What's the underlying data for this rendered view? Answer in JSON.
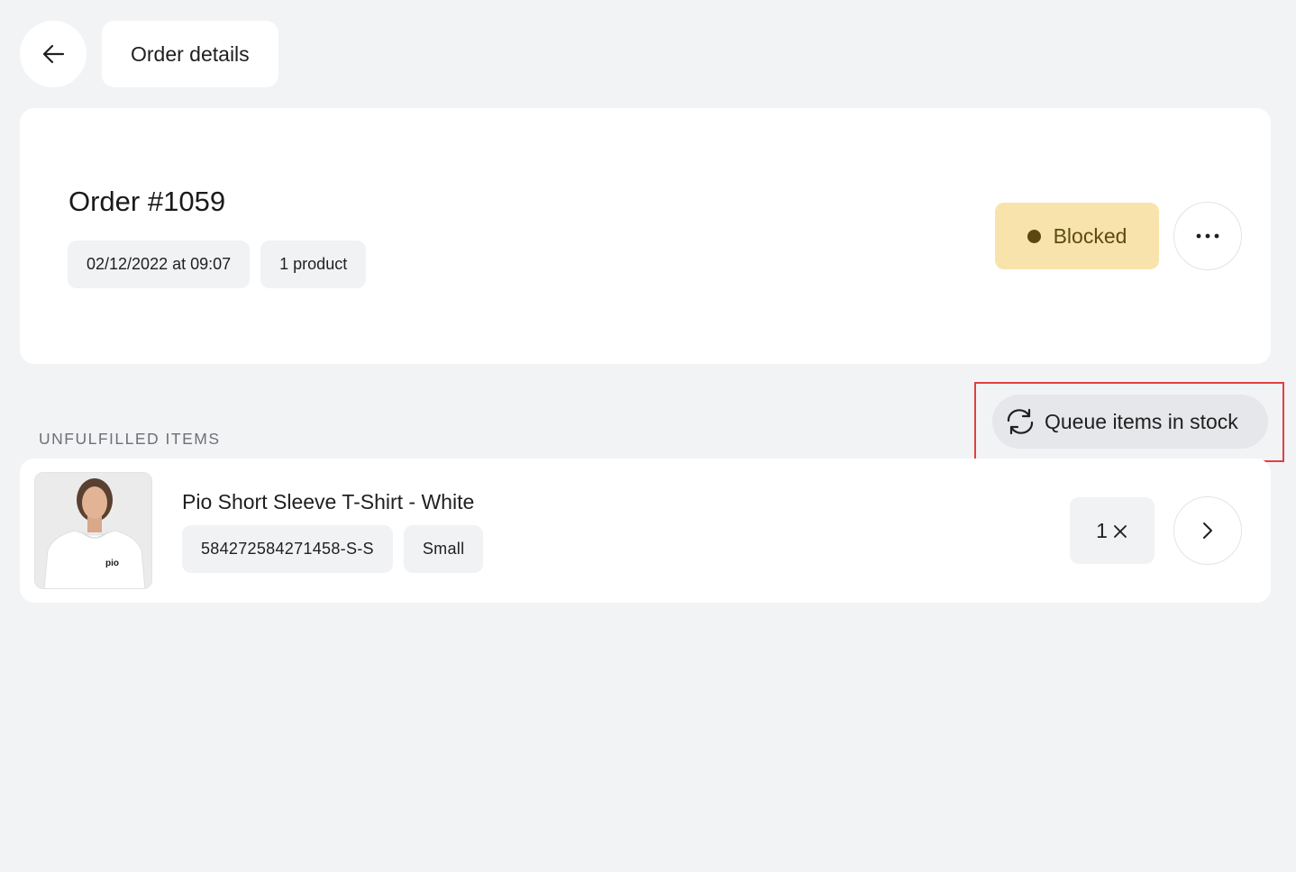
{
  "header": {
    "back_icon": "arrow-left-icon",
    "title": "Order details"
  },
  "order": {
    "title": "Order #1059",
    "date": "02/12/2022 at 09:07",
    "product_count": "1 product",
    "status": "Blocked",
    "status_color": "#f8e3ac",
    "status_dot_color": "#5c4712",
    "more_icon": "more-horizontal-icon"
  },
  "unfulfilled": {
    "section_label": "UNFULFILLED ITEMS",
    "queue_button_label": "Queue items in stock",
    "queue_icon": "refresh-icon",
    "highlight_color": "#e04040",
    "items": [
      {
        "name": "Pio Short Sleeve T-Shirt - White",
        "sku": "584272584271458-S-S",
        "size": "Small",
        "quantity": "1",
        "thumbnail_text": "pio",
        "next_icon": "chevron-right-icon"
      }
    ]
  }
}
